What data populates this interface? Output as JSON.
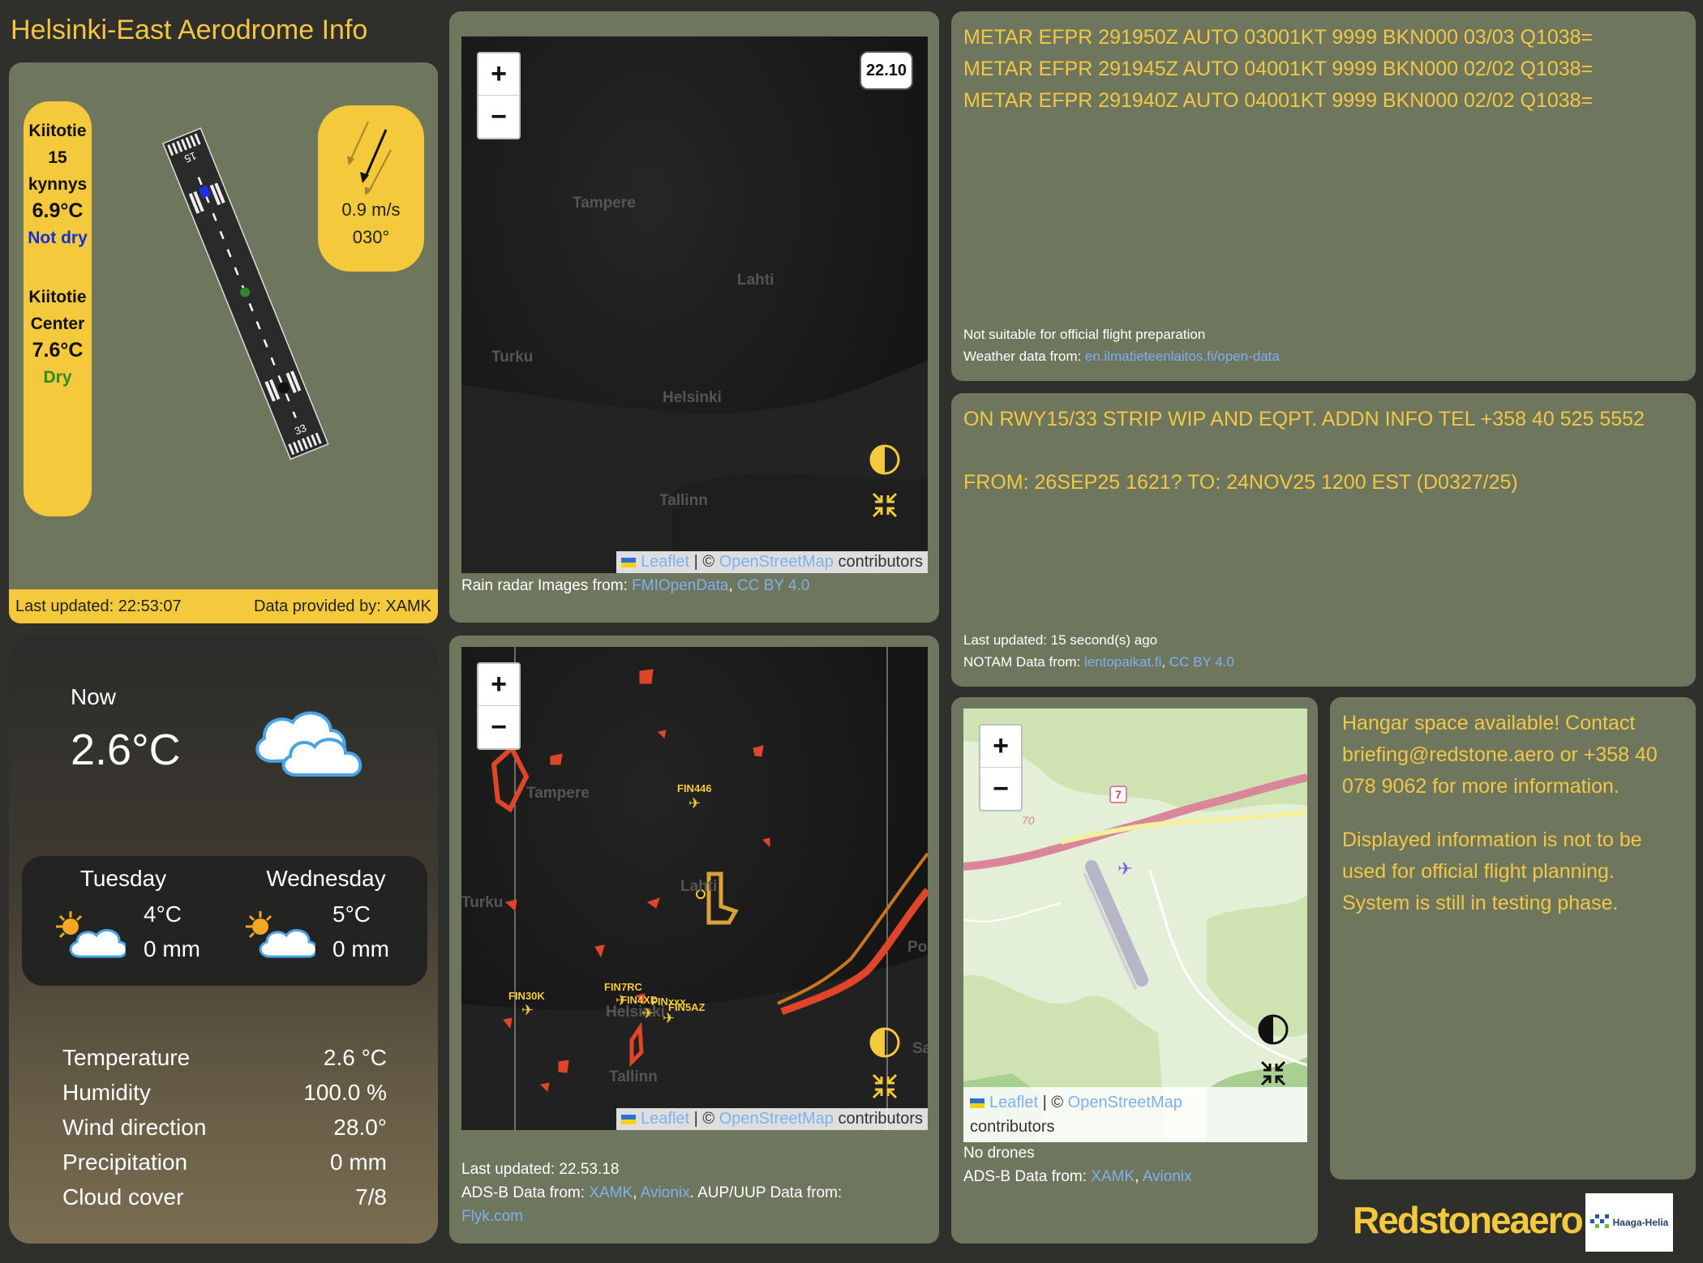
{
  "app": {
    "title": "Helsinki-East Aerodrome Info"
  },
  "runway": {
    "threshold_name_1": "Kiitotie",
    "threshold_name_2": "15",
    "threshold_name_3": "kynnys",
    "threshold_temp": "6.9°C",
    "threshold_state": "Not dry",
    "threshold_state_color": "#1530d6",
    "center_name_1": "Kiitotie",
    "center_name_2": "Center",
    "center_temp": "7.6°C",
    "center_state": "Dry",
    "center_state_color": "#2f8a25",
    "rwy_number_top": "15",
    "rwy_number_bottom": "33",
    "wind_speed": "0.9 m/s",
    "wind_dir": "030°",
    "last_updated": "Last updated: 22:53:07",
    "data_provider": "Data provided by: XAMK"
  },
  "radar_map": {
    "time_badge": "22.10",
    "cities": [
      "Tampere",
      "Lahti",
      "Turku",
      "Helsinki",
      "Tallinn"
    ],
    "zoom_in": "+",
    "zoom_out": "−",
    "attr_leaflet": "Leaflet",
    "attr_sep": " | © ",
    "attr_osm": "OpenStreetMap",
    "attr_suffix": " contributors",
    "source_prefix": "Rain radar Images from: ",
    "source_link1": "FMIOpenData",
    "source_sep": ", ",
    "source_link2": "CC BY 4.0"
  },
  "metar": {
    "lines": [
      "METAR EFPR 291950Z AUTO 03001KT 9999 BKN000 03/03 Q1038=",
      "METAR EFPR 291945Z AUTO 04001KT 9999 BKN000 02/02 Q1038=",
      "METAR EFPR 291940Z AUTO 04001KT 9999 BKN000 02/02 Q1038="
    ],
    "disclaimer": "Not suitable for official flight preparation",
    "source_prefix": "Weather data from: ",
    "source_link": "en.ilmatieteenlaitos.fi/open-data"
  },
  "notam": {
    "text": "ON RWY15/33 STRIP WIP AND EQPT. ADDN INFO TEL +358 40 525 5552",
    "validity": "FROM: 26SEP25 1621? TO: 24NOV25 1200 EST (D0327/25)",
    "last_updated": "Last updated: 15 second(s) ago",
    "source_prefix": "NOTAM Data from: ",
    "source_link1": "lentopaikat.fi",
    "source_sep": ", ",
    "source_link2": "CC BY 4.0"
  },
  "weather": {
    "now_label": "Now",
    "now_temp": "2.6°C",
    "forecast": [
      {
        "day": "Tuesday",
        "temp": "4°C",
        "precip": "0 mm"
      },
      {
        "day": "Wednesday",
        "temp": "5°C",
        "precip": "0 mm"
      }
    ],
    "rows": [
      {
        "label": "Temperature",
        "value": "2.6 °C"
      },
      {
        "label": "Humidity",
        "value": "100.0 %"
      },
      {
        "label": "Wind direction",
        "value": "28.0°"
      },
      {
        "label": "Precipitation",
        "value": "0 mm"
      },
      {
        "label": "Cloud cover",
        "value": "7/8"
      }
    ]
  },
  "adsb_map": {
    "cities": [
      "Tampere",
      "Lahti",
      "Helsinki",
      "Tallinn",
      "Turku",
      "Porvoo",
      "Sa"
    ],
    "flights": [
      "FIN446",
      "FIN30K",
      "FIN7RC",
      "FIN4XD",
      "FIN5AZ",
      "FINxxx"
    ],
    "last_updated": "Last updated: 22.53.18",
    "source_prefix": "ADS-B Data from: ",
    "source_link1": "XAMK",
    "source_sep": ", ",
    "source_link2": "Avionix",
    "aup_prefix": ". AUP/UUP Data from:",
    "aup_link": "Flyk.com"
  },
  "local_map": {
    "road_number": "7",
    "road_label": "70",
    "attr_leaflet": "Leaflet",
    "attr_sep": " | © ",
    "attr_osm": "OpenStreetMap",
    "attr_suffix": "contributors",
    "no_drones": "No drones",
    "source_prefix": "ADS-B Data from: ",
    "source_link1": "XAMK",
    "source_sep": ", ",
    "source_link2": "Avionix"
  },
  "info": {
    "para1": "Hangar space available! Contact briefing@redstone.aero or +358 40 078 9062 for more information.",
    "para2": "Displayed information is not to be used for official flight planning. System is still in testing phase.",
    "logo_text": "Redstoneaero",
    "partner_logo": "Haaga-Helia"
  }
}
